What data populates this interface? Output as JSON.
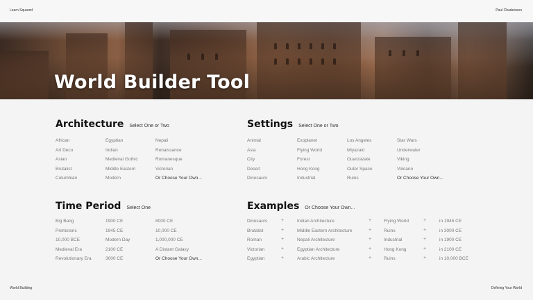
{
  "header": {
    "left": "Learn Squared",
    "right": "Paul Chadeisson"
  },
  "hero": {
    "title": "World Builder Tool"
  },
  "architecture": {
    "title": "Architecture",
    "subtitle": "Select One or Two",
    "columns": [
      [
        "African",
        "Art Deco",
        "Asian",
        "Brutalist",
        "Columbian"
      ],
      [
        "Egyptian",
        "Indian",
        "Medieval Gothic",
        "Middle Eastern",
        "Modern"
      ],
      [
        "Nepali",
        "Renaissance",
        "Romanesque",
        "Victorian",
        "Or Choose Your Own..."
      ]
    ]
  },
  "settings": {
    "title": "Settings",
    "subtitle": "Select One or Two",
    "columns": [
      [
        "Animal",
        "Asia",
        "City",
        "Desert",
        "Dinosaurs"
      ],
      [
        "Exoplanet",
        "Flying World",
        "Forest",
        "Hong Kong",
        "Industrial"
      ],
      [
        "Los Angeles",
        "Miyazaki",
        "Ouarzazate",
        "Outer Space",
        "Ruins"
      ],
      [
        "Star Wars",
        "Underwater",
        "Viking",
        "Volcano",
        "Or Choose Your Own..."
      ]
    ]
  },
  "time_period": {
    "title": "Time Period",
    "subtitle": "Select One",
    "columns": [
      [
        "Big Bang",
        "Prehistoric",
        "10,000 BCE",
        "Medieval Era",
        "Revolutionary Era"
      ],
      [
        "1900 CE",
        "1945 CE",
        "Modern Day",
        "2100 CE",
        "3000 CE"
      ],
      [
        "8000 CE",
        "10,000 CE",
        "1,000,000 CE",
        "A Distant Galaxy",
        "Or Choose Your Own..."
      ]
    ]
  },
  "examples": {
    "title": "Examples",
    "subtitle": "Or Choose Your Own...",
    "plus": "+",
    "columns": [
      [
        "Dinosaurs",
        "Brutalist",
        "Roman",
        "Victorian",
        "Egyptian"
      ],
      [
        "Indian Architecture",
        "Middle Eastern Architecture",
        "Nepali Architecture",
        "Egyptian Architecture",
        "Arabic Architecture"
      ],
      [
        "Flying World",
        "Ruins",
        "Industrial",
        "Hong Kong",
        "Ruins"
      ],
      [
        "in 1945 CE",
        "in 3000 CE",
        "in 1900 CE",
        "in 2100 CE",
        "in 10,000 BCE"
      ]
    ]
  },
  "footer": {
    "left": "World Building",
    "right": "Defining Your World"
  }
}
